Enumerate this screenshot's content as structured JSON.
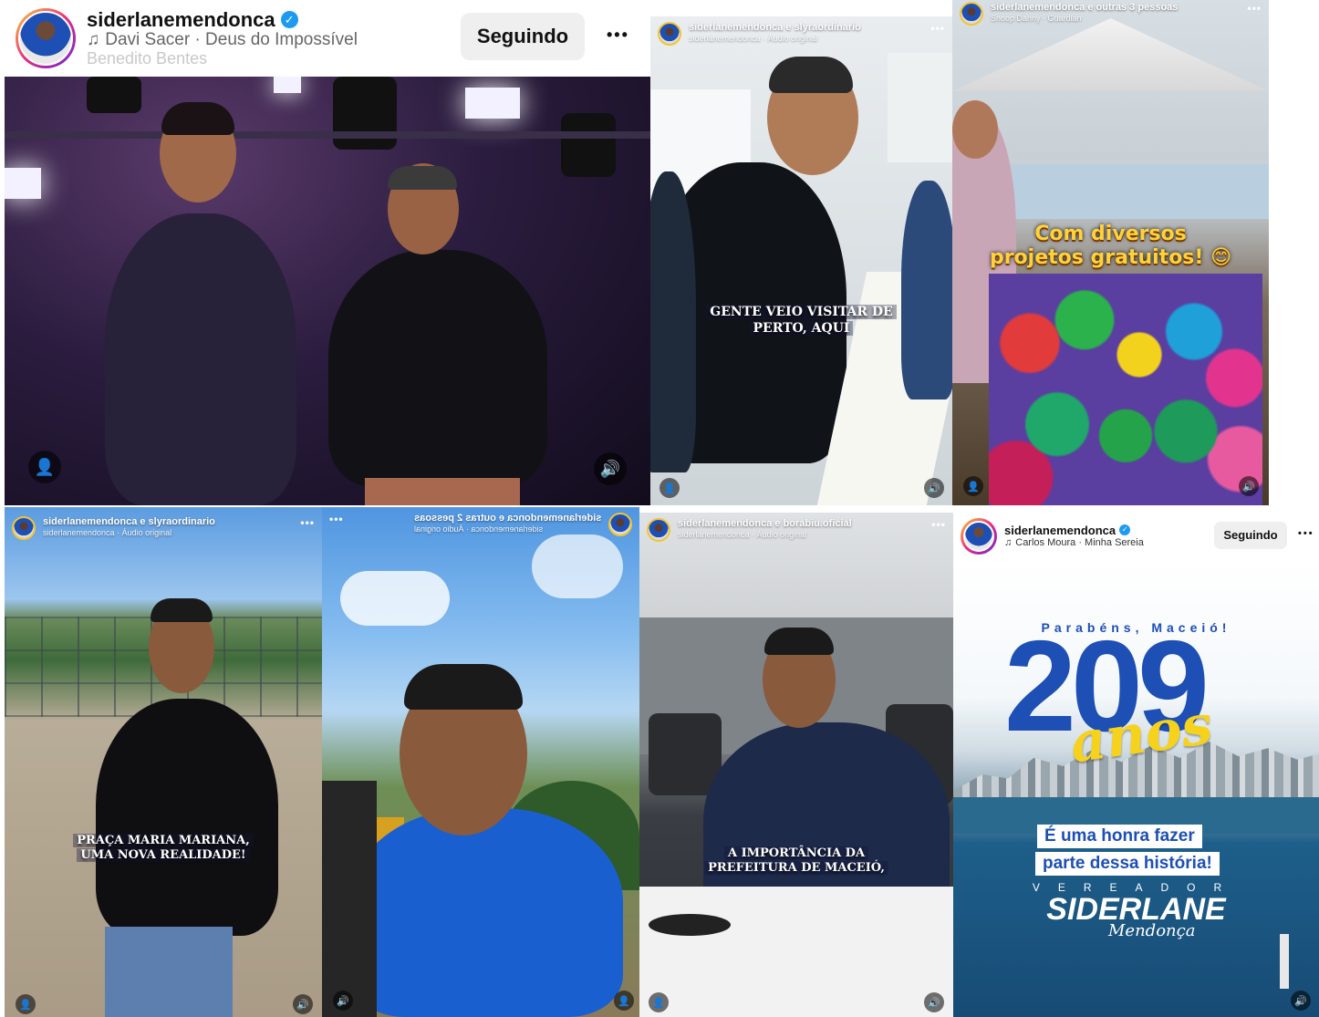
{
  "main_post": {
    "username": "siderlanemendonca",
    "music": "Davi Sacer · Deus do Impossível",
    "location": "Benedito Bentes",
    "follow_label": "Seguindo",
    "more_label": "•••"
  },
  "reel_a": {
    "username": "siderlanemendonca e slyraordinario",
    "audio": "siderlanemendonca · Áudio original",
    "caption_line1": "GENTE VEIO VISITAR DE",
    "caption_line2": "PERTO, AQUI"
  },
  "reel_b": {
    "username": "siderlanemendonca e outras 3 pessoas",
    "audio": "Snoop Danny · Guardian",
    "caption_line1": "Com diversos",
    "caption_line2": "projetos gratuitos! 😊"
  },
  "reel_c": {
    "username": "siderlanemendonca e slyraordinario",
    "audio": "siderlanemendonca · Áudio original",
    "caption_line1": "PRAÇA MARIA MARIANA,",
    "caption_line2": "UMA NOVA REALIDADE!"
  },
  "reel_d": {
    "username": "siderlanemendonca e outras 2 pessoas",
    "audio": "siderlanemendonca · Áudio original"
  },
  "reel_e": {
    "username": "siderlanemendonca e borabiu.oficial",
    "audio": "siderlanemendonca · Áudio original",
    "caption_line1": "A IMPORTÂNCIA DA",
    "caption_line2": "PREFEITURA DE MACEIÓ,"
  },
  "post_f": {
    "username": "siderlanemendonca",
    "music": "Carlos Moura · Minha Sereia",
    "follow_label": "Seguindo",
    "more_label": "•••",
    "kicker": "Parabéns, Maceió!",
    "number": "209",
    "anos": "anos",
    "line1": "É uma honra fazer",
    "line2": "parte dessa história!",
    "role": "VEREADOR",
    "name": "SIDERLANE",
    "surname": "Mendonça"
  },
  "icons": {
    "more": "•••",
    "music": "♫",
    "user": "👤",
    "volume": "🔊",
    "verified": "✓"
  },
  "colors": {
    "brand_blue": "#1d4fb5",
    "verified": "#1d9bf0",
    "anos_yellow": "#f6d21c",
    "caption_yellow": "#ffd23a"
  }
}
